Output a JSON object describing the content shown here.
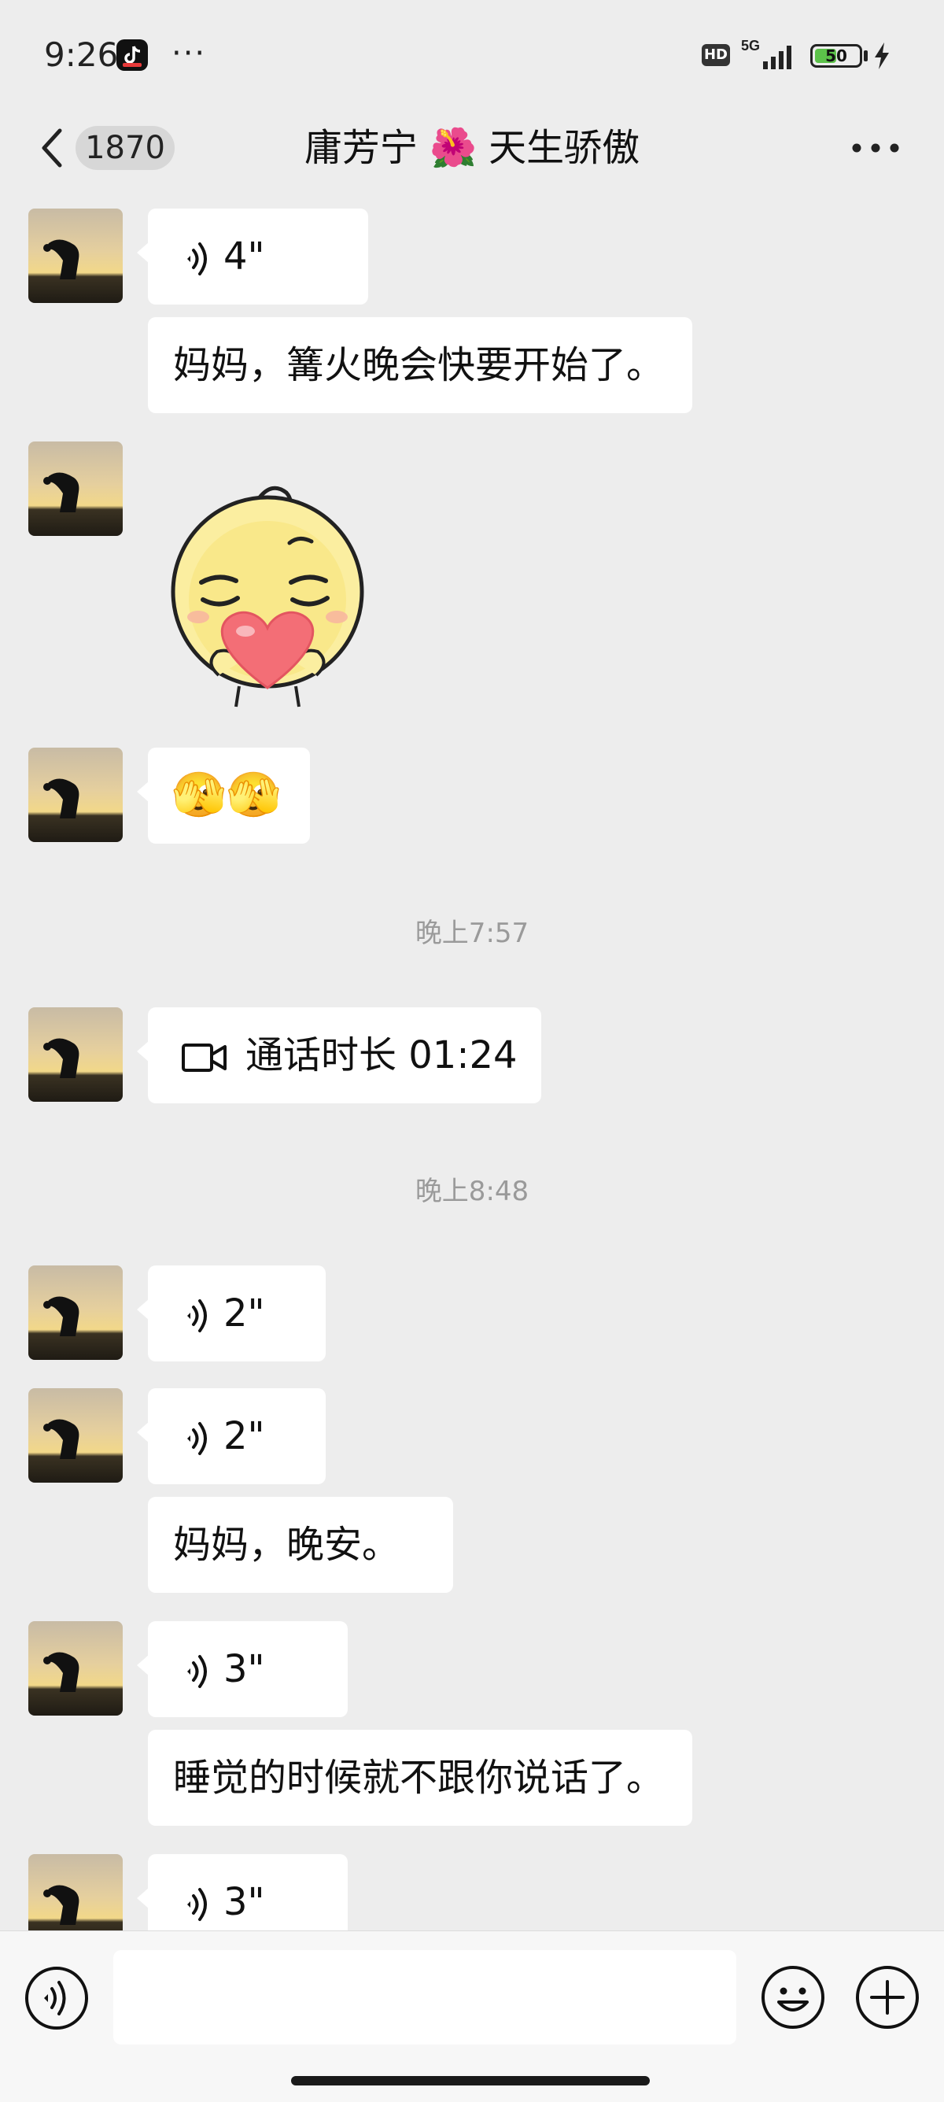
{
  "status_bar": {
    "time": "9:26",
    "more": "···",
    "hd_label": "HD",
    "network": "5G",
    "battery_level": "50",
    "battery_percent": 50
  },
  "header": {
    "back_icon": "chevron-left-icon",
    "unread_count": "1870",
    "title": "庸芳宁 🌺 天生骄傲",
    "more_icon": "more-dots-icon"
  },
  "messages": [
    {
      "type": "voice",
      "duration": "4\""
    },
    {
      "type": "text",
      "text": "妈妈，篝火晚会快要开始了。"
    },
    {
      "type": "sticker",
      "description": "heart-sticker"
    },
    {
      "type": "emoji",
      "emoji": "🫣🫣"
    },
    {
      "type": "time",
      "text": "晚上7:57"
    },
    {
      "type": "video_call",
      "text": "通话时长 01:24"
    },
    {
      "type": "time",
      "text": "晚上8:48"
    },
    {
      "type": "voice",
      "duration": "2\""
    },
    {
      "type": "voice",
      "duration": "2\""
    },
    {
      "type": "text",
      "text": "妈妈，晚安。"
    },
    {
      "type": "voice",
      "duration": "3\""
    },
    {
      "type": "text",
      "text": "睡觉的时候就不跟你说话了。"
    },
    {
      "type": "voice",
      "duration": "3\""
    }
  ],
  "input_bar": {
    "voice_icon": "voice-input-icon",
    "emoji_icon": "emoji-icon",
    "plus_icon": "plus-icon",
    "field_value": ""
  },
  "colors": {
    "background": "#ededed",
    "bubble": "#ffffff",
    "timestamp": "#9a9a9a",
    "battery_fill": "#5cc24a"
  }
}
